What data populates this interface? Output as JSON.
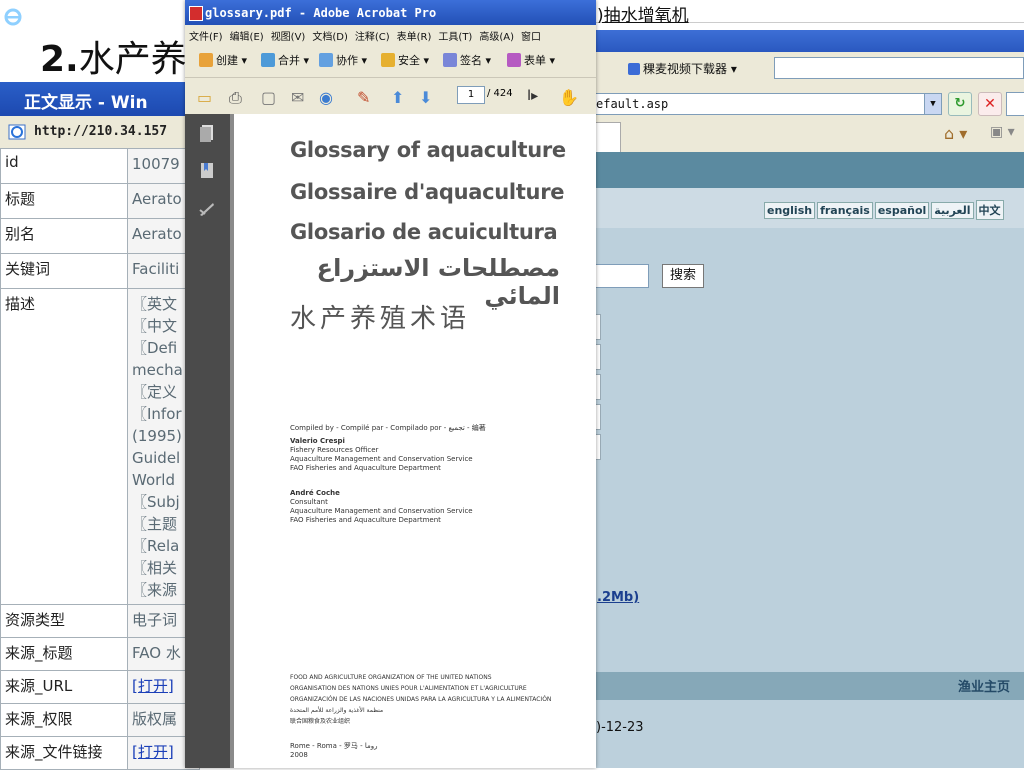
{
  "slide": {
    "title_num": "2.",
    "title_text": "水产养"
  },
  "top_snippet": ")抽水增氧机",
  "ie": {
    "title": "正文显示 - Win",
    "address": "http://210.34.157"
  },
  "right_window": {
    "downloader": "稞麦视频下载器",
    "url": "efault.asp",
    "languages": [
      "english",
      "français",
      "español",
      "العربية",
      "中文"
    ],
    "search_button": "搜索",
    "size_link": ".2Mb)",
    "fisheries_home": "渔业主页",
    "date": ")-12-23"
  },
  "metadata_table": [
    {
      "key": "id",
      "value": "10079"
    },
    {
      "key": "标题",
      "value": "Aerato"
    },
    {
      "key": "别名",
      "value": "Aerato"
    },
    {
      "key": "关键词",
      "value": "Faciliti"
    },
    {
      "key": "描述",
      "value": "〖英文\n〖中文\n〖Defi\nmecha\n〖定义\n〖Infor\n(1995)\nGuidel\nWorld\n〖Subj\n〖主题\n〖Rela\n〖相关\n〖来源"
    },
    {
      "key": "资源类型",
      "value": "电子词"
    },
    {
      "key": "来源_标题",
      "value": "FAO 水"
    },
    {
      "key": "来源_URL",
      "value": "[打开]",
      "link": true
    },
    {
      "key": "来源_权限",
      "value": "版权属"
    },
    {
      "key": "来源_文件链接",
      "value": "[打开]",
      "link": true
    }
  ],
  "acrobat": {
    "title": "glossary.pdf - Adobe Acrobat Pro",
    "menu": [
      "文件(F)",
      "编辑(E)",
      "视图(V)",
      "文档(D)",
      "注释(C)",
      "表单(R)",
      "工具(T)",
      "高级(A)",
      "窗口"
    ],
    "toolbar": [
      "创建",
      "合并",
      "协作",
      "安全",
      "签名",
      "表单"
    ],
    "page_current": "1",
    "page_total": "/ 424"
  },
  "pdf": {
    "titles": [
      "Glossary of aquaculture",
      "Glossaire d'aquaculture",
      "Glosario de acuicultura"
    ],
    "arabic": "مصطلحات الاستزراع المائي",
    "chinese": "水产养殖术语",
    "compiled_by": "Compiled by - Compilé par - Compilado por - تجميع - 编著",
    "author1_name": "Valerio Crespi",
    "author1_lines": [
      "Fishery Resources Officer",
      "Aquaculture Management and Conservation Service",
      "FAO Fisheries and Aquaculture Department"
    ],
    "author2_name": "André Coche",
    "author2_lines": [
      "Consultant",
      "Aquaculture Management and Conservation Service",
      "FAO Fisheries and Aquaculture Department"
    ],
    "org_lines": [
      "FOOD AND AGRICULTURE ORGANIZATION OF THE UNITED NATIONS",
      "ORGANISATION DES NATIONS UNIES POUR L'ALIMENTATION ET L'AGRICULTURE",
      "ORGANIZACIÓN DE LAS NACIONES UNIDAS PARA LA AGRICULTURA Y LA ALIMENTACIÓN",
      "منظمة الأغذية والزراعة للأمم المتحدة",
      "联合国粮食及农业组织"
    ],
    "place": "Rome - Roma - 罗马 - روما",
    "year": "2008"
  }
}
